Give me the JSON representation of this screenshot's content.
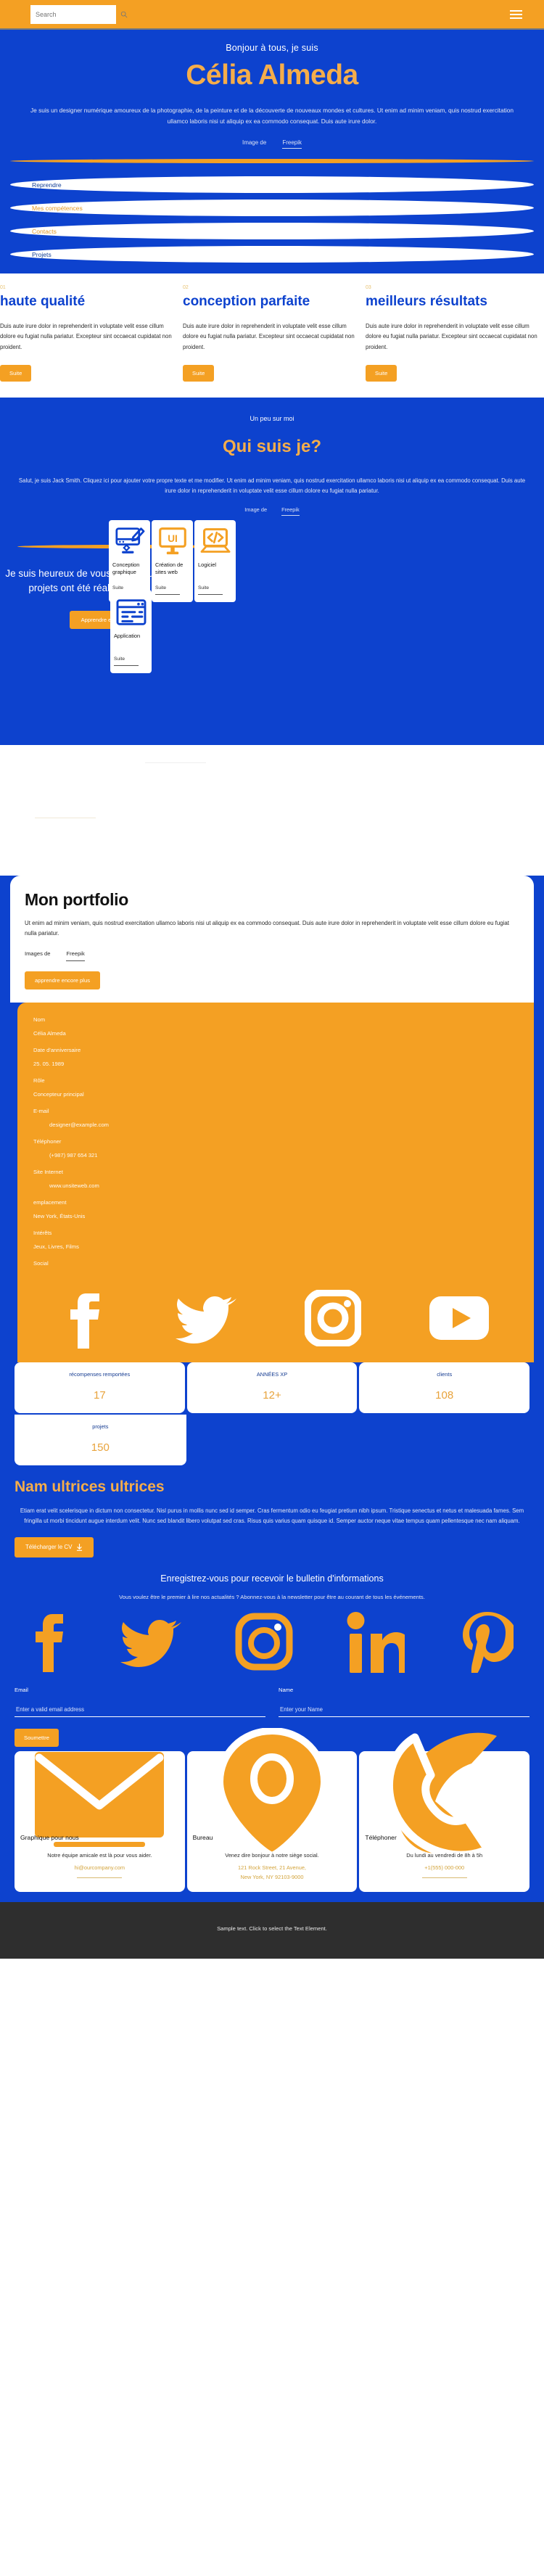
{
  "topbar": {
    "search_placeholder": "Search",
    "search_value": "",
    "search_icon": "search-icon",
    "menu_icon": "hamburger-menu-icon"
  },
  "hero": {
    "greeting": "Bonjour à tous, je suis",
    "name": "Célia Almeda",
    "description": "Je suis un designer numérique amoureux de la photographie, de la peinture et de la découverte de nouveaux mondes et cultures. Ut enim ad minim veniam, quis nostrud exercitation ullamco laboris nisi ut aliquip ex ea commodo consequat. Duis aute irure dolor.",
    "credit_prefix": "Image de",
    "credit_link": "Freepik",
    "nav": [
      {
        "label": "Reprendre",
        "style": "blue"
      },
      {
        "label": "Mes compétences",
        "style": "orange"
      },
      {
        "label": "Contacts",
        "style": "orange"
      },
      {
        "label": "Projets",
        "style": "blue"
      }
    ]
  },
  "features": [
    {
      "number": "01",
      "title": "haute qualité",
      "body": "Duis aute irure dolor in reprehenderit in voluptate velit esse cillum dolore eu fugiat nulla pariatur. Excepteur sint occaecat cupidatat non proident.",
      "button": "Suite"
    },
    {
      "number": "02",
      "title": "conception parfaite",
      "body": "Duis aute irure dolor in reprehenderit in voluptate velit esse cillum dolore eu fugiat nulla pariatur. Excepteur sint occaecat cupidatat non proident.",
      "button": "Suite"
    },
    {
      "number": "03",
      "title": "meilleurs résultats",
      "body": "Duis aute irure dolor in reprehenderit in voluptate velit esse cillum dolore eu fugiat nulla pariatur. Excepteur sint occaecat cupidatat non proident.",
      "button": "Suite"
    }
  ],
  "about": {
    "eyebrow": "Un peu sur moi",
    "title": "Qui suis je?",
    "description": "Salut, je suis Jack Smith. Cliquez ici pour ajouter votre propre texte et me modifier. Ut enim ad minim veniam, quis nostrud exercitation ullamco laboris nisi ut aliquip ex ea commodo consequat. Duis aute irure dolor in reprehenderit in voluptate velit esse cillum dolore eu fugiat nulla pariatur.",
    "credit_prefix": "Image de",
    "credit_link": "Freepik",
    "happy_text": "Je suis heureux de vous savoir que plus de 300 projets ont été réalisés avec succès !",
    "happy_button": "Apprendre encore plus",
    "services": [
      {
        "name": "Conception graphique",
        "more": "Suite",
        "icon": "monitor-paintbrush-icon"
      },
      {
        "name": "Création de sites web",
        "more": "Suite",
        "icon": "monitor-ui-icon"
      },
      {
        "name": "Logiciel",
        "more": "Suite",
        "icon": "laptop-code-icon"
      },
      {
        "name": "Application",
        "more": "Suite",
        "icon": "browser-window-icon"
      }
    ]
  },
  "portfolio": {
    "title": "Mon portfolio",
    "description": "Ut enim ad minim veniam, quis nostrud exercitation ullamco laboris nisi ut aliquip ex ea commodo consequat. Duis aute irure dolor in reprehenderit in voluptate velit esse cillum dolore eu fugiat nulla pariatur.",
    "credit_prefix": "Images de",
    "credit_link": "Freepik",
    "button": "apprendre encore plus"
  },
  "info": [
    {
      "label": "Nom",
      "value": "Célia Almeda",
      "indent": false
    },
    {
      "label": "Date d'anniversaire",
      "value": "25. 05. 1989",
      "indent": false
    },
    {
      "label": "Rôle",
      "value": "Concepteur principal",
      "indent": false
    },
    {
      "label": "E-mail",
      "value": "designer@example.com",
      "indent": true
    },
    {
      "label": "Téléphoner",
      "value": "(+987) 987 654 321",
      "indent": true
    },
    {
      "label": "Site Internet",
      "value": "www.unsiteweb.com",
      "indent": true
    },
    {
      "label": "emplacement",
      "value": "New York, États-Unis",
      "indent": false
    },
    {
      "label": "Intérêts",
      "value": "Jeux, Livres, Films",
      "indent": false
    },
    {
      "label": "Social",
      "value": "",
      "indent": false
    }
  ],
  "social_big": [
    {
      "name": "facebook-icon"
    },
    {
      "name": "twitter-icon"
    },
    {
      "name": "instagram-icon"
    },
    {
      "name": "youtube-icon"
    }
  ],
  "stats": [
    {
      "label": "récompenses remportées",
      "value": "17"
    },
    {
      "label": "ANNÉES XP",
      "value": "12+"
    },
    {
      "label": "clients",
      "value": "108"
    },
    {
      "label": "projets",
      "value": "150"
    }
  ],
  "nam": {
    "title": "Nam ultrices ultrices",
    "body": "Etiam erat velit scelerisque in dictum non consectetur. Nisl purus in mollis nunc sed id semper. Cras fermentum odio eu feugiat pretium nibh ipsum. Tristique senectus et netus et malesuada fames. Sem fringilla ut morbi tincidunt augue interdum velit. Nunc sed blandit libero volutpat sed cras. Risus quis varius quam quisque id. Semper auctor neque vitae tempus quam pellentesque nec nam aliquam.",
    "button": "Télécharger le CV",
    "button_icon": "download-icon"
  },
  "newsletter": {
    "heading": "Enregistrez-vous pour recevoir le bulletin d'informations",
    "subtext": "Vous voulez être le premier à lire nos actualités ? Abonnez-vous à la newsletter pour être au courant de tous les événements.",
    "socials": [
      {
        "name": "facebook-icon"
      },
      {
        "name": "twitter-icon"
      },
      {
        "name": "instagram-icon"
      },
      {
        "name": "linkedin-icon"
      },
      {
        "name": "pinterest-icon"
      }
    ],
    "email_label": "Email",
    "email_placeholder": "Enter a valid email address",
    "email_value": "",
    "name_label": "Name",
    "name_placeholder": "Enter your Name",
    "name_value": "",
    "submit": "Soumettre"
  },
  "contact_cards": [
    {
      "icon": "envelope-icon",
      "title": "Graphique pour nous",
      "body": "Notre équipe amicale est là pour vous aider.",
      "link": "hi@ourcompany.com"
    },
    {
      "icon": "map-pin-icon",
      "title": "Bureau",
      "body": "Venez dire bonjour à notre siège social.",
      "link": "121 Rock Street, 21 Avenue,\nNew York, NY 92103-9000"
    },
    {
      "icon": "phone-icon",
      "title": "Téléphoner",
      "body": "Du lundi au vendredi de 8h à 5h",
      "link": "+1(555) 000-000"
    }
  ],
  "footer": {
    "text": "Sample text. Click to select the Text Element."
  },
  "colors": {
    "brand_blue": "#0D42CE",
    "brand_orange": "#F4A023",
    "accent_gold": "#F5AD4A",
    "footer_dark": "#2e2e2e"
  }
}
